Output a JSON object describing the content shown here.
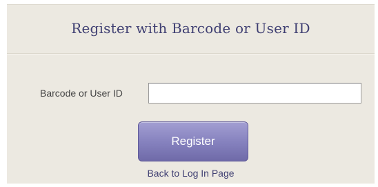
{
  "header": {
    "title": "Register with Barcode or User ID"
  },
  "form": {
    "field_label": "Barcode or User ID",
    "field_value": ""
  },
  "actions": {
    "register_label": "Register",
    "back_link_label": "Back to Log In Page"
  },
  "colors": {
    "panel_background": "#ece9e1",
    "title_text": "#3f3f72",
    "button_background": "#8480bd",
    "link_text": "#3f3f72"
  }
}
